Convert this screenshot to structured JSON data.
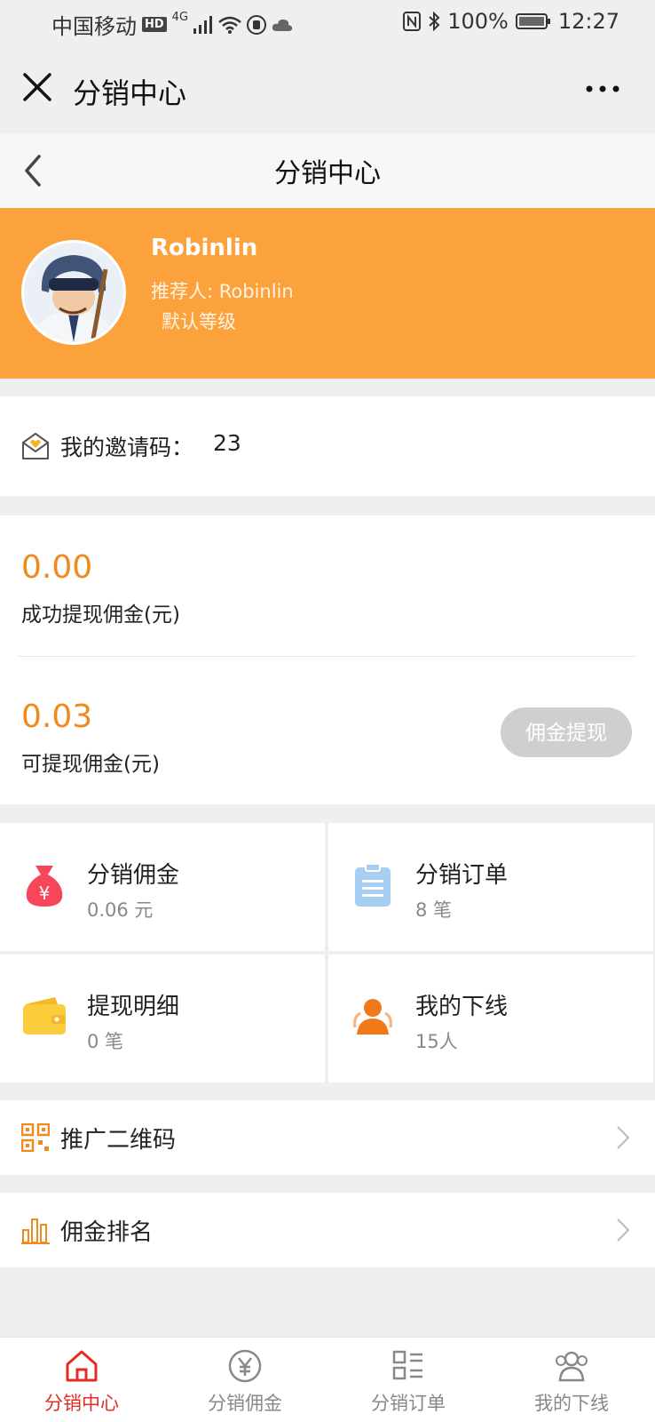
{
  "status_bar": {
    "carrier": "中国移动",
    "hd": "HD",
    "network": "4G",
    "battery": "100%",
    "time": "12:27"
  },
  "wechat_bar": {
    "title": "分销中心"
  },
  "page_header": {
    "title": "分销中心"
  },
  "profile": {
    "name": "Robinlin",
    "referrer": "推荐人: Robinlin",
    "level": "默认等级"
  },
  "invite": {
    "label": "我的邀请码：",
    "code": "23"
  },
  "commission": {
    "withdrawn_amount": "0.00",
    "withdrawn_label": "成功提现佣金(元)",
    "available_amount": "0.03",
    "available_label": "可提现佣金(元)",
    "withdraw_button": "佣金提现"
  },
  "grid": {
    "items": [
      {
        "title": "分销佣金",
        "sub": "0.06 元",
        "icon": "money-bag-icon"
      },
      {
        "title": "分销订单",
        "sub": "8 笔",
        "icon": "clipboard-icon"
      },
      {
        "title": "提现明细",
        "sub": "0 笔",
        "icon": "wallet-icon"
      },
      {
        "title": "我的下线",
        "sub": "15人",
        "icon": "people-icon"
      }
    ]
  },
  "menu": {
    "qrcode_label": "推广二维码",
    "ranking_label": "佣金排名"
  },
  "tabbar": {
    "tabs": [
      {
        "label": "分销中心",
        "icon": "home-icon"
      },
      {
        "label": "分销佣金",
        "icon": "yen-circle-icon"
      },
      {
        "label": "分销订单",
        "icon": "list-icon"
      },
      {
        "label": "我的下线",
        "icon": "people-icon"
      }
    ]
  },
  "colors": {
    "accent": "#fca23d",
    "amount": "#f08a1c",
    "active_tab": "#e02e24"
  }
}
